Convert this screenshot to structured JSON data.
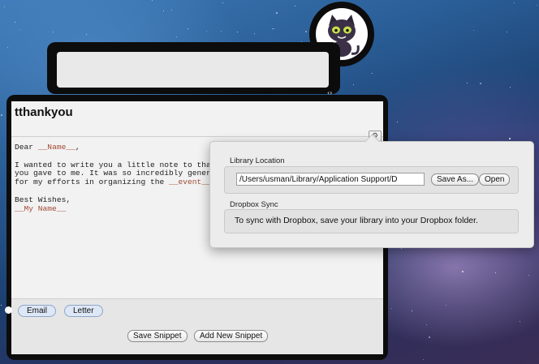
{
  "snippet": {
    "title": "tthankyou",
    "body": {
      "line1_prefix": "Dear ",
      "name_placeholder": "__Name__",
      "line1_suffix": ",",
      "line3": "I wanted to write you a little note to thank",
      "line4": "you gave to me. It was so incredibly genero",
      "line5_prefix": "for my efforts in organizing the ",
      "event_placeholder": "__event__",
      "line5_suffix": ".",
      "line7": "Best Wishes,",
      "my_name_placeholder": "__My Name__"
    },
    "tags": [
      "Email",
      "Letter"
    ]
  },
  "buttons": {
    "save_snippet": "Save Snippet",
    "add_new_snippet": "Add New Snippet"
  },
  "popover": {
    "library_location_label": "Library Location",
    "library_path_value": "/Users/usman/Library/Application Support/D",
    "save_as_label": "Save As...",
    "open_label": "Open",
    "dropbox_sync_label": "Dropbox Sync",
    "dropbox_sync_text": "To sync with Dropbox, save your library into your Dropbox folder."
  },
  "icons": {
    "gear": "gear-icon",
    "avatar": "cat-avatar",
    "chevron": "chevron-updown-icon"
  },
  "colors": {
    "placeholder_text": "#a24a35",
    "tag_fill": "#dde7f6",
    "window_frame": "#0c0c0c"
  }
}
